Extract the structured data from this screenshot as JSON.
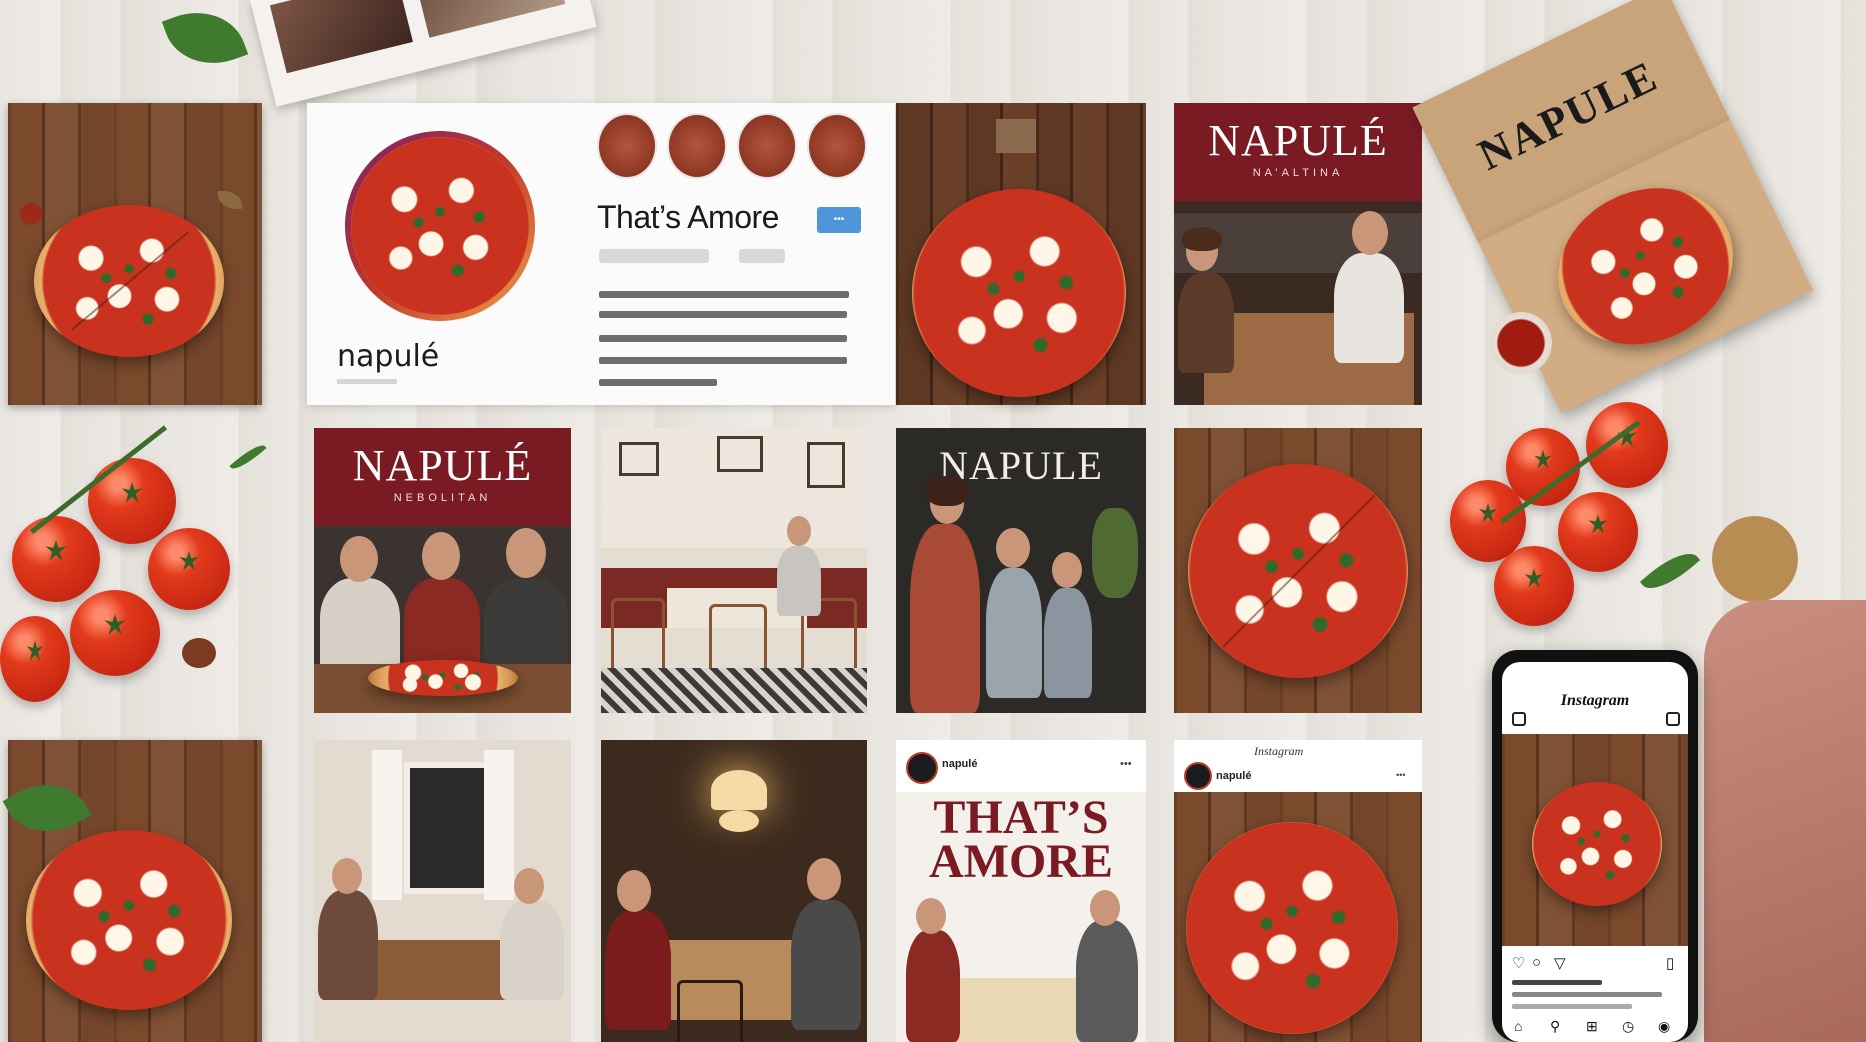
{
  "profile": {
    "headline": "That’s Amore",
    "handle": "napulé",
    "follow_label": "•••"
  },
  "posts": [
    {
      "brand": "NAPULÉ",
      "sub": "NA’ALTINA"
    },
    {
      "brand": "NAPULÉ",
      "sub": "NEBOLITAN"
    },
    {
      "brand": "NAPULE",
      "sub": ""
    },
    {
      "username": "napulé",
      "caption": "THAT’S AMORE"
    },
    {
      "username": "napulé",
      "app_name": "Instagram"
    }
  ],
  "phone": {
    "app_name": "Instagram",
    "icons": [
      "heart-icon",
      "comment-icon",
      "share-icon",
      "bookmark-icon",
      "home-icon",
      "search-icon",
      "add-icon",
      "reels-icon",
      "profile-icon"
    ]
  },
  "box": {
    "brand": "NAPULE"
  },
  "colors": {
    "brand_red": "#7a1a22",
    "tomato": "#d6321b",
    "wood": "#6e4128",
    "table": "#ece9e4"
  }
}
